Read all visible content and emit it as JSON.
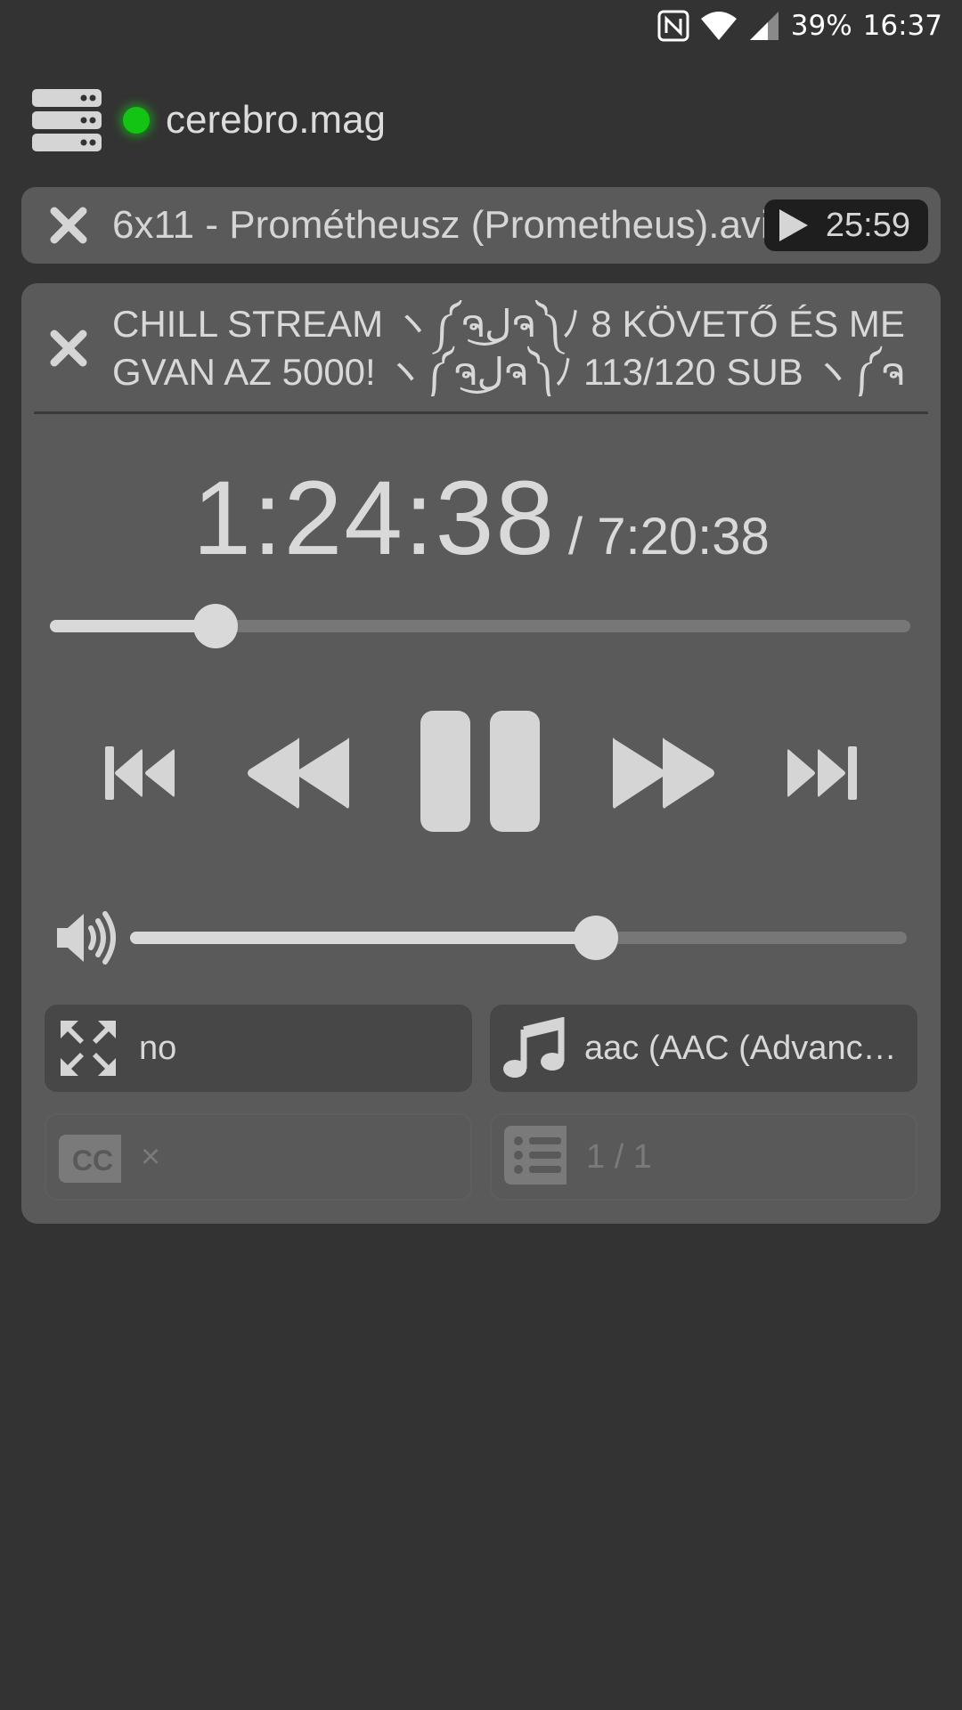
{
  "status_bar": {
    "battery": "39%",
    "time": "16:37",
    "icons": [
      "nfc-icon",
      "wifi-icon",
      "signal-icon"
    ]
  },
  "header": {
    "server_icon": "server-icon",
    "connection_status_color": "#14c414",
    "host": "cerebro.mag"
  },
  "queue_item": {
    "title": "6x11 - Prométheusz (Prometheus).avi",
    "duration": "25:59",
    "play_icon": "play-icon",
    "close_icon": "close-icon"
  },
  "player": {
    "title": "CHILL STREAM ヽ༼ຈل͜ຈ༽ﾉ 8 KÖVETŐ ÉS MEGVAN AZ 5000! ヽ༼ຈل͜ຈ༽ﾉ 113/120 SUB ヽ༼ຈ",
    "current_time": "1:24:38",
    "total_time": "/ 7:20:38",
    "progress_fraction": 0.193,
    "volume_fraction": 0.6,
    "controls": [
      "skip-previous-icon",
      "rewind-icon",
      "pause-icon",
      "fast-forward-icon",
      "skip-next-icon"
    ],
    "options": {
      "fullscreen": {
        "icon": "fullscreen-icon",
        "value": "no"
      },
      "audio_track": {
        "icon": "music-note-icon",
        "value": "aac (AAC (Advanc…"
      },
      "subtitles": {
        "icon": "cc-icon",
        "value": "×"
      },
      "playlist": {
        "icon": "playlist-icon",
        "value": "1 / 1"
      }
    }
  },
  "colors": {
    "background": "#333333",
    "card": "#5a5a5a",
    "accent": "#d9d9d9",
    "connected": "#14c414"
  }
}
